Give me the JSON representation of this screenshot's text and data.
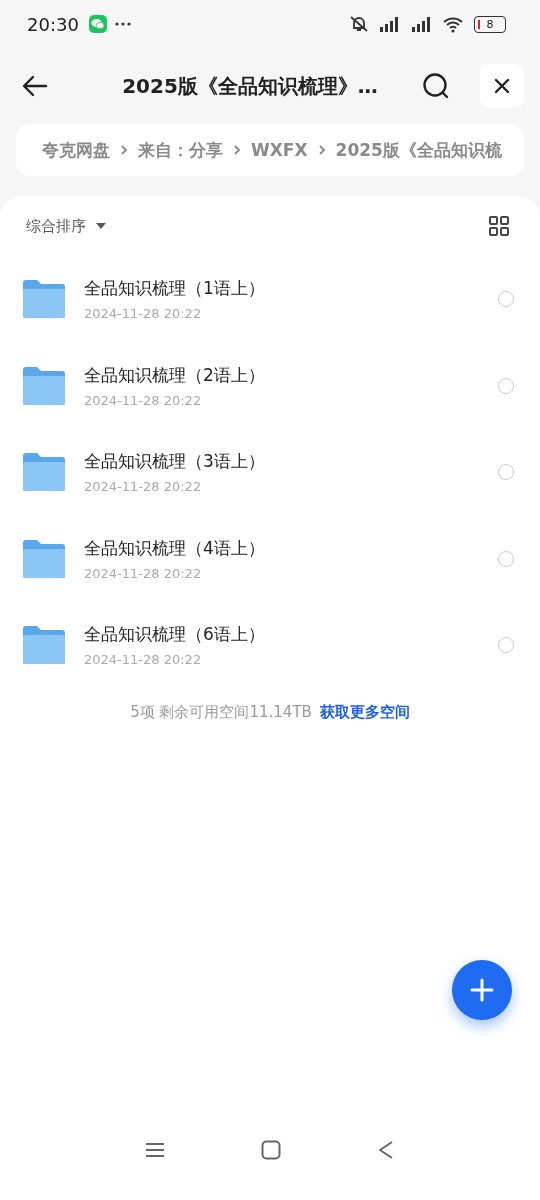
{
  "status_bar": {
    "time": "20:30",
    "battery": "8"
  },
  "header": {
    "title": "2025版《全品知识梳理》…"
  },
  "breadcrumb": [
    "夸克网盘",
    "来自：分享",
    "WXFX",
    "2025版《全品知识梳"
  ],
  "sort": {
    "label": "综合排序"
  },
  "files": [
    {
      "name": "全品知识梳理（1语上）",
      "date": "2024-11-28 20:22",
      "selected": false
    },
    {
      "name": "全品知识梳理（2语上）",
      "date": "2024-11-28 20:22",
      "selected": false
    },
    {
      "name": "全品知识梳理（3语上）",
      "date": "2024-11-28 20:22",
      "selected": false
    },
    {
      "name": "全品知识梳理（4语上）",
      "date": "2024-11-28 20:22",
      "selected": false
    },
    {
      "name": "全品知识梳理（6语上）",
      "date": "2024-11-28 20:22",
      "selected": false
    }
  ],
  "footer": {
    "summary": "5项 剩余可用空间11.14TB",
    "link": "获取更多空间"
  }
}
